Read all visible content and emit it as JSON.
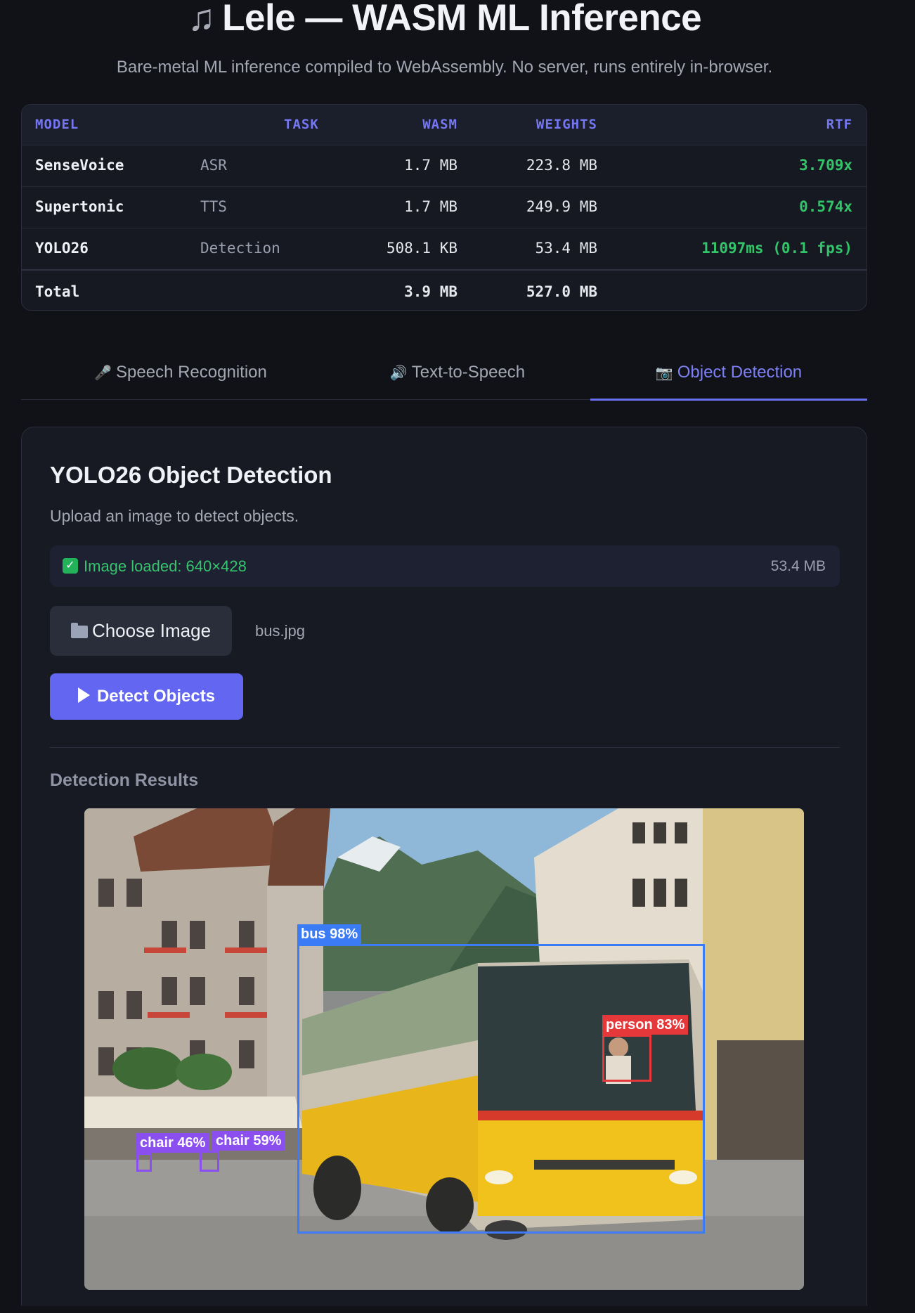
{
  "header": {
    "title_icon": "music-note-icon",
    "title": "Lele — WASM ML Inference",
    "subtitle": "Bare-metal ML inference compiled to WebAssembly. No server, runs entirely in-browser."
  },
  "models_table": {
    "columns": [
      "MODEL",
      "TASK",
      "WASM",
      "WEIGHTS",
      "RTF"
    ],
    "rows": [
      {
        "model": "SenseVoice",
        "task": "ASR",
        "wasm": "1.7 MB",
        "weights": "223.8 MB",
        "rtf": "3.709x"
      },
      {
        "model": "Supertonic",
        "task": "TTS",
        "wasm": "1.7 MB",
        "weights": "249.9 MB",
        "rtf": "0.574x"
      },
      {
        "model": "YOLO26",
        "task": "Detection",
        "wasm": "508.1 KB",
        "weights": "53.4 MB",
        "rtf": "11097ms (0.1 fps)"
      }
    ],
    "total": {
      "label": "Total",
      "wasm": "3.9 MB",
      "weights": "527.0 MB"
    },
    "rtf_color": "#33c46a",
    "header_color": "#7477f0"
  },
  "tabs": [
    {
      "icon": "microphone-icon",
      "label": "Speech Recognition",
      "active": false
    },
    {
      "icon": "speaker-icon",
      "label": "Text-to-Speech",
      "active": false
    },
    {
      "icon": "camera-icon",
      "label": "Object Detection",
      "active": true
    }
  ],
  "detection_panel": {
    "title": "YOLO26 Object Detection",
    "description": "Upload an image to detect objects.",
    "status": {
      "icon": "check-icon",
      "text": "Image loaded: 640×428",
      "size": "53.4 MB"
    },
    "choose_button": {
      "icon": "folder-icon",
      "label": "Choose Image"
    },
    "file_name": "bus.jpg",
    "detect_button": {
      "icon": "play-icon",
      "label": "Detect Objects"
    },
    "results_title": "Detection Results",
    "detections": [
      {
        "label": "bus 98%",
        "color": "#3b7bf5"
      },
      {
        "label": "person 83%",
        "color": "#e5383b"
      },
      {
        "label": "chair 46%",
        "color": "#8b4ff0"
      },
      {
        "label": "chair 59%",
        "color": "#8b4ff0"
      }
    ]
  },
  "colors": {
    "accent": "#6366f1",
    "background": "#111217",
    "card": "#181a23"
  }
}
